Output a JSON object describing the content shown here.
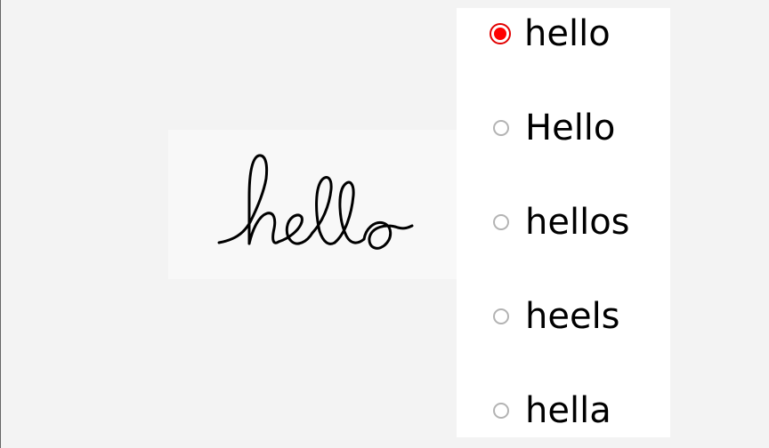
{
  "handwriting": {
    "text": "hello",
    "ink_color": "#000000"
  },
  "suggestions": [
    {
      "label": "hello",
      "selected": true
    },
    {
      "label": "Hello",
      "selected": false
    },
    {
      "label": "hellos",
      "selected": false
    },
    {
      "label": "heels",
      "selected": false
    },
    {
      "label": "hella",
      "selected": false
    }
  ],
  "colors": {
    "selected_radio": "#ff0000",
    "unselected_radio": "#b3b3b3",
    "panel_background": "#ffffff",
    "screen_background": "#f3f3f3"
  }
}
